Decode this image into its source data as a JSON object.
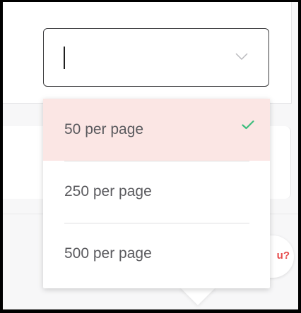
{
  "select": {
    "value": "",
    "chevron_icon": "chevron-down-icon"
  },
  "menu": {
    "options": [
      {
        "label": "50 per page",
        "selected": true
      },
      {
        "label": "250 per page",
        "selected": false
      },
      {
        "label": "500 per page",
        "selected": false
      }
    ],
    "selected_icon": "check-icon",
    "selected_bg": "#fbe6e4",
    "check_color": "#3dbd7d"
  },
  "chat_widget": {
    "partial_text": "u?"
  }
}
